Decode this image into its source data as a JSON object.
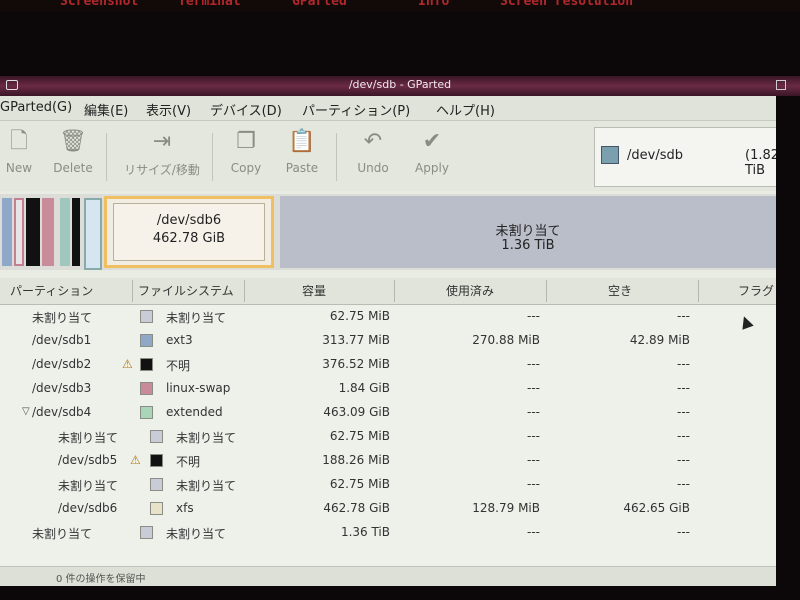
{
  "desktop": {
    "top_items": [
      "Screenshot",
      "Terminal",
      "GParted",
      "Info",
      "Screen resolution"
    ]
  },
  "window": {
    "title": "/dev/sdb - GParted"
  },
  "menu": [
    "GParted(G)",
    "編集(E)",
    "表示(V)",
    "デバイス(D)",
    "パーティション(P)",
    "ヘルプ(H)"
  ],
  "toolbar": {
    "new": "New",
    "delete": "Delete",
    "resize": "リサイズ/移動",
    "copy": "Copy",
    "paste": "Paste",
    "undo": "Undo",
    "apply": "Apply"
  },
  "device": {
    "name": "/dev/sdb",
    "size": "(1.82 TiB"
  },
  "partition_map": {
    "selected_name": "/dev/sdb6",
    "selected_size": "462.78 GiB",
    "unalloc_label": "未割り当て",
    "unalloc_size": "1.36 TiB"
  },
  "table": {
    "headers": [
      "パーティション",
      "ファイルシステム",
      "容量",
      "使用済み",
      "空き",
      "フラグ"
    ],
    "rows": [
      {
        "partition": "未割り当て",
        "fs": "未割り当て",
        "size": "62.75 MiB",
        "used": "---",
        "free": "---",
        "color": "#c9ccd6",
        "indent": 0,
        "warn": false
      },
      {
        "partition": "/dev/sdb1",
        "fs": "ext3",
        "size": "313.77 MiB",
        "used": "270.88 MiB",
        "free": "42.89 MiB",
        "color": "#8fa8c8",
        "indent": 0,
        "warn": false
      },
      {
        "partition": "/dev/sdb2",
        "fs": "不明",
        "size": "376.52 MiB",
        "used": "---",
        "free": "---",
        "color": "#111111",
        "indent": 0,
        "warn": true
      },
      {
        "partition": "/dev/sdb3",
        "fs": "linux-swap",
        "size": "1.84 GiB",
        "used": "---",
        "free": "---",
        "color": "#c98a9a",
        "indent": 0,
        "warn": false
      },
      {
        "partition": "/dev/sdb4",
        "fs": "extended",
        "size": "463.09 GiB",
        "used": "---",
        "free": "---",
        "color": "#a9d6b8",
        "indent": 0,
        "warn": false,
        "expander": "▽"
      },
      {
        "partition": "未割り当て",
        "fs": "未割り当て",
        "size": "62.75 MiB",
        "used": "---",
        "free": "---",
        "color": "#c9ccd6",
        "indent": 1,
        "warn": false
      },
      {
        "partition": "/dev/sdb5",
        "fs": "不明",
        "size": "188.26 MiB",
        "used": "---",
        "free": "---",
        "color": "#111111",
        "indent": 1,
        "warn": true
      },
      {
        "partition": "未割り当て",
        "fs": "未割り当て",
        "size": "62.75 MiB",
        "used": "---",
        "free": "---",
        "color": "#c9ccd6",
        "indent": 1,
        "warn": false
      },
      {
        "partition": "/dev/sdb6",
        "fs": "xfs",
        "size": "462.78 GiB",
        "used": "128.79 MiB",
        "free": "462.65 GiB",
        "color": "#e8e2c8",
        "indent": 1,
        "warn": false
      },
      {
        "partition": "未割り当て",
        "fs": "未割り当て",
        "size": "1.36 TiB",
        "used": "---",
        "free": "---",
        "color": "#c9ccd6",
        "indent": 0,
        "warn": false
      }
    ]
  },
  "status": {
    "text": "0 件の操作を保留中"
  }
}
